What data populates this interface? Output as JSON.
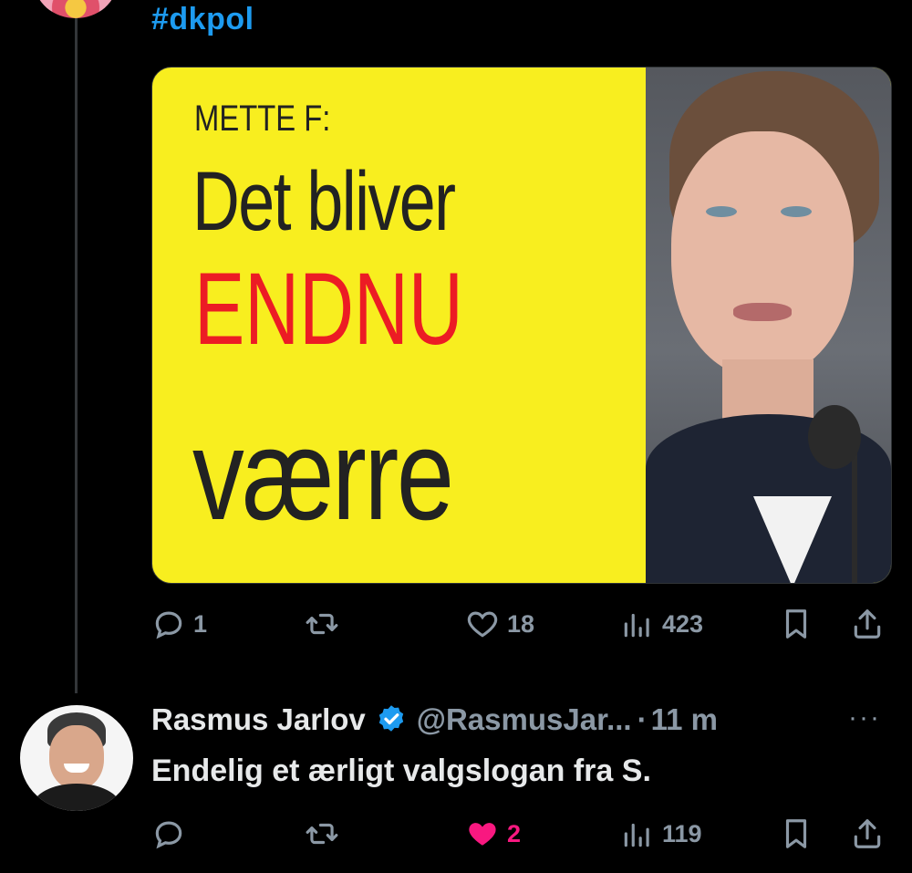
{
  "thread": {
    "hashtag": "#dkpol"
  },
  "media": {
    "headline_line1": "METTE F:",
    "headline_line2": "Det bliver",
    "headline_line3": "ENDNU",
    "headline_line4": "værre",
    "headline_accent_color": "#ec1c24",
    "background_color": "#f8ee1f"
  },
  "tweet1_actions": {
    "reply_count": "1",
    "retweet_count": "",
    "like_count": "18",
    "views_count": "423"
  },
  "reply": {
    "name": "Rasmus Jarlov",
    "handle": "@RasmusJar...",
    "separator": "·",
    "time": "11 m",
    "more": "···",
    "text": "Endelig et ærligt valgslogan fra S."
  },
  "tweet2_actions": {
    "reply_count": "",
    "retweet_count": "",
    "like_count": "2",
    "views_count": "119",
    "liked_color": "#f91880"
  },
  "colors": {
    "link": "#1d9bf0",
    "muted": "#8b98a5",
    "text": "#e7e9ea",
    "verified": "#1d9bf0"
  }
}
